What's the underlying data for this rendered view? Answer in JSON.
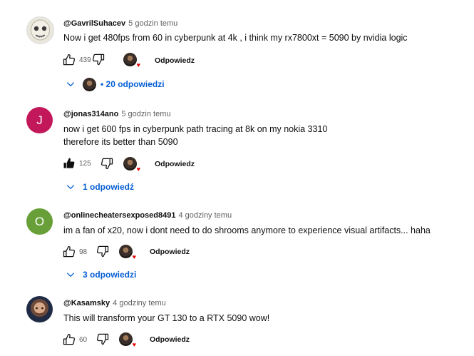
{
  "ui": {
    "reply_label": "Odpowiedz"
  },
  "comments": [
    {
      "author": "@GavrilSuhacev",
      "time": "5 godzin temu",
      "lines": [
        "Now i get 480fps from 60 in cyberpunk at 4k , i think my rx7800xt = 5090 by nvidia logic"
      ],
      "likes": "439",
      "liked": false,
      "replies": "• 20 odpowiedzi",
      "replies_with_avatar": true
    },
    {
      "author": "@jonas314ano",
      "time": "5 godzin temu",
      "avatar_letter": "J",
      "avatar_color": "#c2185b",
      "lines": [
        "now i get 600 fps in cyberpunk path tracing at 8k on my nokia 3310",
        "therefore its better than 5090"
      ],
      "likes": "125",
      "liked": true,
      "replies": "1 odpowiedź"
    },
    {
      "author": "@onlinecheatersexposed8491",
      "time": "4 godziny temu",
      "avatar_letter": "O",
      "avatar_color": "#689f38",
      "lines": [
        "im a fan of x20, now i dont need to do shrooms anymore to experience visual artifacts... haha"
      ],
      "likes": "98",
      "liked": false,
      "replies": "3 odpowiedzi"
    },
    {
      "author": "@Kasamsky",
      "time": "4 godziny temu",
      "lines": [
        "This will transform your GT 130 to a RTX 5090 wow!"
      ],
      "likes": "60",
      "liked": false
    }
  ]
}
